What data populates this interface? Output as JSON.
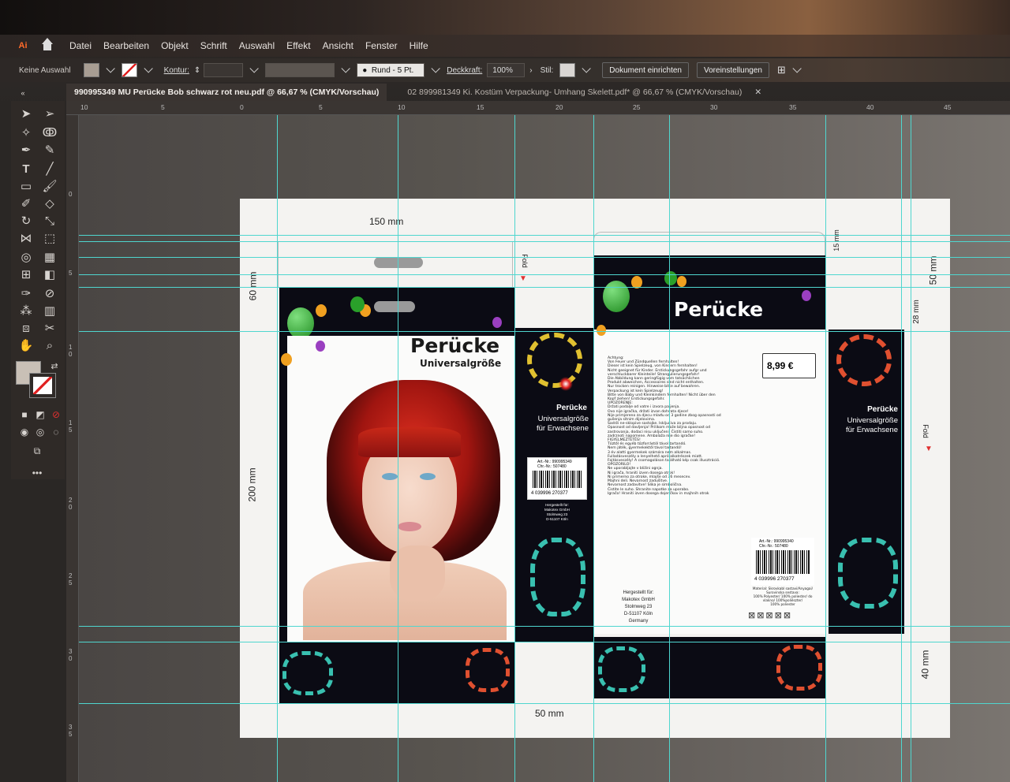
{
  "menubar": {
    "app_logo": "Ai",
    "items": [
      "Datei",
      "Bearbeiten",
      "Objekt",
      "Schrift",
      "Auswahl",
      "Effekt",
      "Ansicht",
      "Fenster",
      "Hilfe"
    ]
  },
  "controlbar": {
    "selection_state": "Keine Auswahl",
    "stroke_label": "Kontur:",
    "brush_preset": "Rund - 5 Pt.",
    "opacity_label": "Deckkraft:",
    "opacity_value": "100%",
    "style_label": "Stil:",
    "document_setup_button": "Dokument einrichten",
    "preferences_button": "Voreinstellungen"
  },
  "tabs": [
    {
      "label": "990995349 MU Perücke Bob schwarz rot neu.pdf @ 66,67 % (CMYK/Vorschau)",
      "active": true
    },
    {
      "label": "02 899981349 Ki. Kostüm Verpackung- Umhang Skelett.pdf* @ 66,67 % (CMYK/Vorschau)",
      "active": false
    }
  ],
  "ruler_top": [
    "10",
    "5",
    "0",
    "5",
    "10",
    "15",
    "20",
    "25",
    "30",
    "35",
    "40",
    "45"
  ],
  "ruler_left": [
    "0",
    "5",
    "1 0",
    "1 5",
    "2 0",
    "2 5",
    "3 0",
    "3 5"
  ],
  "artboard": {
    "dims": {
      "width_150": "150 mm",
      "height_60": "60 mm",
      "height_200": "200 mm",
      "width_50": "50 mm",
      "height_15": "15 mm",
      "height_50": "50 mm",
      "height_28": "28 mm",
      "height_40": "40 mm"
    },
    "fold_label": "Fold",
    "front": {
      "title": "Perücke",
      "subtitle": "Universalgröße"
    },
    "side": {
      "title": "Perücke",
      "line2": "Universalgröße",
      "line3": "für Erwachsene",
      "art_nr": "Art.-Nr.: 990995349",
      "chg_nr": "Chr.-Nr.: 507480",
      "ean": "4 039996 270377",
      "mfr_lines": [
        "Hergestellt für:",
        "Makotex GmbH",
        "Stolmweg 23",
        "D-51107 Köln"
      ]
    },
    "back": {
      "title": "Perücke",
      "price": "8,99 €",
      "warning_lines": [
        "Achtung:",
        "Von Feuer und Zündquellen fernhalten!",
        "Dieser ist kein Spielzeug, von Kindern fernhalten!",
        "Nicht geeignet für Kinder. Erstickungsgefahr aufgr und",
        "verschluckbarer Kleinteile! Strangulierungsgefahr!",
        "Die Abbildung kann geringfügig vom tatsächlichen",
        "Produkt abweichen, Accessoires sind nicht enthalten.",
        "Nur trocken reinigen. Hinweise bitte auf bewahren.",
        "Verpackung ist kein Spielzeug!",
        "Bitte von Baby und Kleinkindern fernhalten! Nicht über den",
        "Kopf ziehen! Erstickungsgefahr.",
        "UPOZORENJE:",
        "Držati podalje od vatre i izvora paljenja.",
        "Ovo nije igračka, držati izvan dohvata djece!",
        "Nije primjereno za djecu mlađu od 3 godine zbog opasnosti od",
        "gušenja sitnim dijelovima.",
        "Sadrži ne-sklopive sastojke. Isključiva za prodaju.",
        "Opasnost od davljenja! Prilikom može biljna opasnost od",
        "zastrovanja, dodaci nisu uključeni. Čistiti samo suho.",
        "zadrznoti napomene. Ambalaža nije dio igračke!",
        "FIGYELMEZTETÉS!",
        "Tűztől és egyéb tűzforrástól távol tartandó.",
        "Nem játék, gyermekektől távol tartandó!",
        "3 év alatti gyermekek számára nem alkalmas.",
        "Fulladásveszély a lenyelhető apró alkatrészek miatt.",
        "Fojtásveszély! A csomagoláson található kép csak illusztráció.",
        "OPOZORILO!",
        "Ne uporabljajte v bližini ognja.",
        "Ni igrača, hraniti izven dosega otrok!",
        "Ni primerno za otroke, mlajše od 36 mesecev.",
        "Majhni deli. Nevarnost zadušitve.",
        "Nevarnost zadavitve! Slika je simbolična.",
        "Čistite le suho. Shranite napotke za uporabo.",
        "Igračo! Hraniti izven dosega dojenčkov in majhnih otrok"
      ],
      "art_nr": "Art.-Nr.: 990995340",
      "chg_nr": "Chr.-Nr.: 507480",
      "ean": "4 039996 270377",
      "material_lines": [
        "Material: Skrovkabl sastavi/Anyagai/",
        "Surovinska sestava:",
        "100% Polyester/ 100% poliester/ do",
        "vlakno/ 100%poliészter/",
        "100% poliester"
      ],
      "mfr_lines": [
        "Hergestellt für:",
        "Makotex GmbH",
        "Stolmweg 23",
        "D-51107 Köln",
        "Germany"
      ]
    }
  },
  "colors": {
    "guide": "#4fd6cf",
    "package_dark": "#0b0b14",
    "accent_red": "#d42020",
    "balloon_green": "#27a02a",
    "balloon_orange": "#f0a020",
    "balloon_purple": "#9a3fc0",
    "fold_arrow": "#e03030"
  }
}
